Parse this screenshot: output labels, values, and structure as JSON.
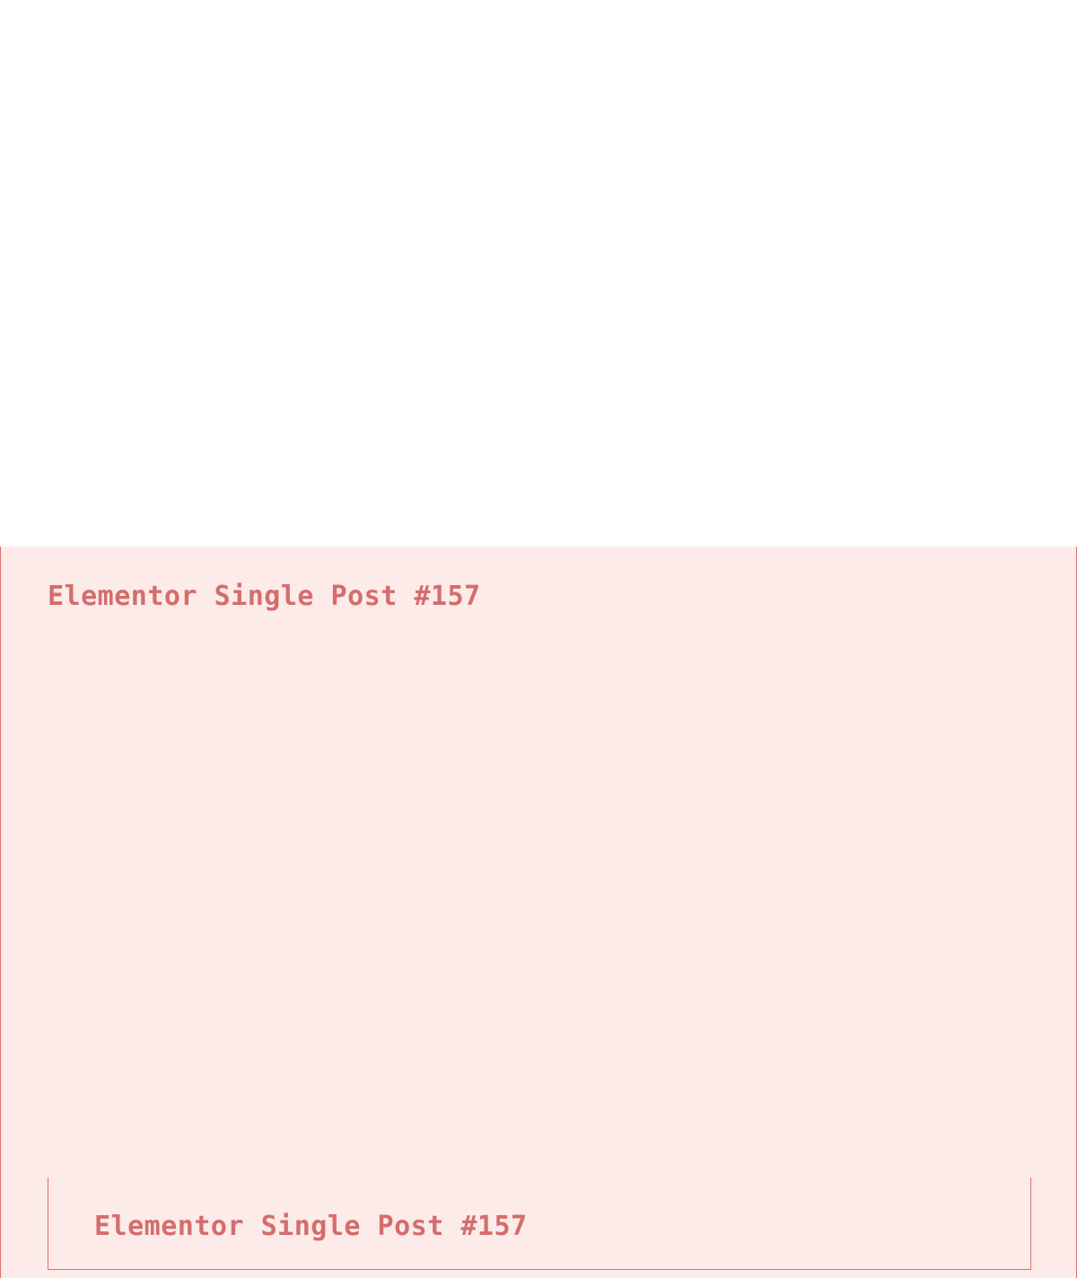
{
  "outer_placeholder": {
    "title": "Elementor Single Post #157"
  },
  "inner_placeholder": {
    "title": "Elementor Single Post #157"
  },
  "colors": {
    "placeholder_background": "#fcebe8",
    "placeholder_border": "#d9706f",
    "placeholder_text": "#d46d6d",
    "page_background": "#ffffff"
  }
}
